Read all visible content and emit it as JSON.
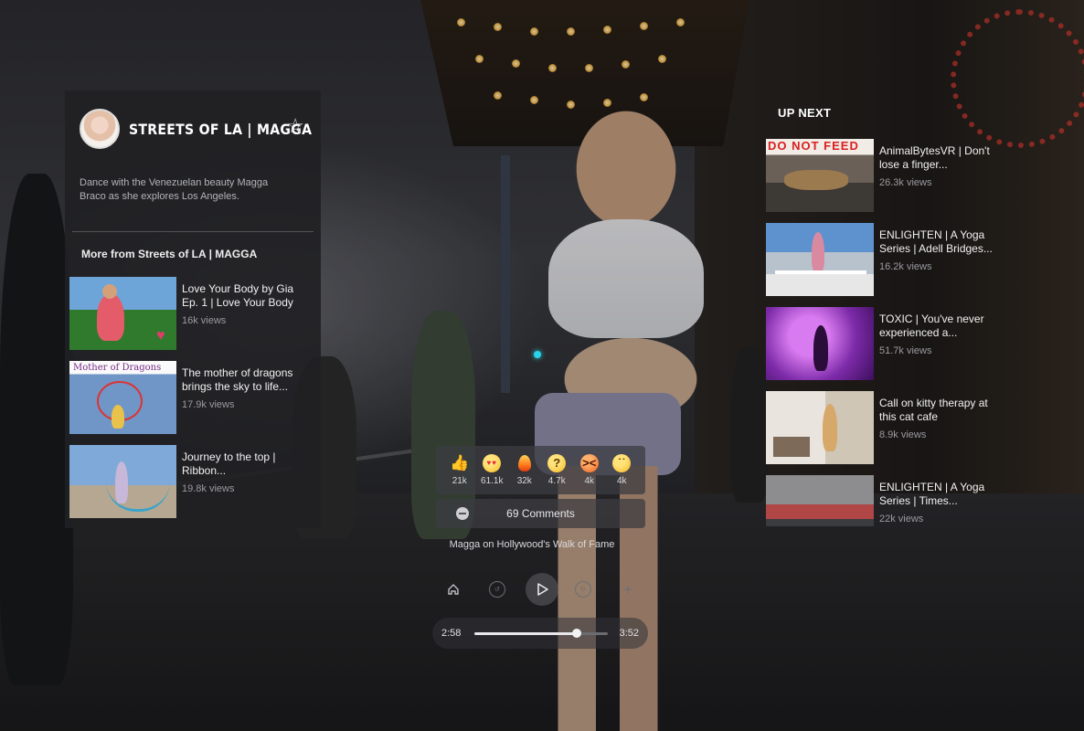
{
  "channel": {
    "name": "STREETS OF LA | MAGGA",
    "description": "Dance with the Venezuelan beauty Magga Braco as she explores Los Angeles."
  },
  "more_from": {
    "title": "More from Streets of LA | MAGGA",
    "items": [
      {
        "title": "Love Your Body by Gia Ep. 1 | Love Your Body",
        "views": "16k views"
      },
      {
        "title": "The mother of dragons brings the sky to life...",
        "views": "17.9k views",
        "thumb_text": "Mother of Dragons"
      },
      {
        "title": "Journey to the top | Ribbon...",
        "views": "19.8k views"
      }
    ]
  },
  "up_next": {
    "title": "UP NEXT",
    "items": [
      {
        "title": "AnimalBytesVR | Don't lose a finger...",
        "views": "26.3k views",
        "thumb_text": "DO NOT FEED"
      },
      {
        "title": "ENLIGHTEN | A Yoga Series | Adell Bridges...",
        "views": "16.2k views"
      },
      {
        "title": "TOXIC | You've never experienced a...",
        "views": "51.7k views"
      },
      {
        "title": "Call on kitty therapy at this cat cafe",
        "views": "8.9k views"
      },
      {
        "title": "ENLIGHTEN | A Yoga Series | Times...",
        "views": "22k views"
      }
    ]
  },
  "reactions": [
    {
      "icon": "thumbs-up-icon",
      "count": "21k"
    },
    {
      "icon": "heart-eyes-icon",
      "count": "61.1k"
    },
    {
      "icon": "fire-icon",
      "count": "32k"
    },
    {
      "icon": "thinking-face-icon",
      "count": "4.7k"
    },
    {
      "icon": "angry-face-icon",
      "count": "4k"
    },
    {
      "icon": "sad-face-icon",
      "count": "4k"
    }
  ],
  "comments": {
    "label": "69 Comments"
  },
  "video": {
    "title": "Magga on Hollywood's Walk of Fame"
  },
  "player": {
    "current_time": "2:58",
    "total_time": "3:52",
    "progress": 0.77
  },
  "colors": {
    "accent": "#29d3e8",
    "panel_bg": "#202024"
  }
}
